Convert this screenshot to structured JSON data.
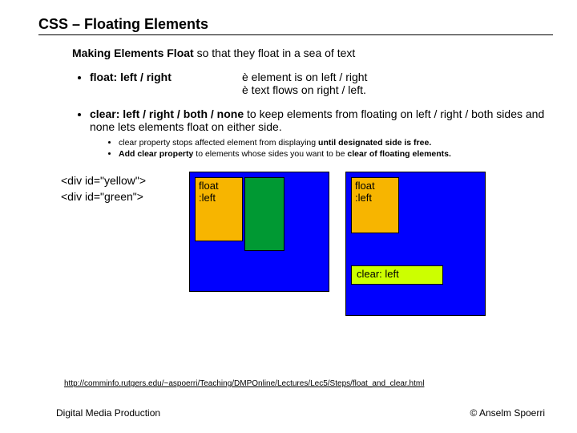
{
  "title": "CSS – Floating Elements",
  "subtitle": {
    "bold": "Making Elements Float",
    "rest": " so that they float in a sea of text"
  },
  "bullet1": {
    "left": "float: left / right",
    "arrow": "è",
    "line1": " element is on left / right",
    "line2": " text flows on right / left."
  },
  "bullet2": {
    "prop": "clear: left / right  / both / none",
    "rest1": " to keep elements from floating on left / right / both sides and none lets elements float on either side.",
    "sub1a": "clear property stops affected element from displaying ",
    "sub1b": "until designated side is free.",
    "sub2a": "Add clear property",
    "sub2b": " to elements whose sides you want to be ",
    "sub2c": "clear of floating elements."
  },
  "code": {
    "line1": "<div id=\"yellow\">",
    "line2": "<div id=\"green\">"
  },
  "labels": {
    "floatleft1": "float",
    "floatleft2": ":left",
    "clearleft": "clear:  left"
  },
  "footer_link": "http://comminfo.rutgers.edu/~aspoerri/Teaching/DMPOnline/Lectures/Lec5/Steps/float_and_clear.html",
  "footer_left": "Digital Media Production",
  "footer_right": "© Anselm Spoerri"
}
